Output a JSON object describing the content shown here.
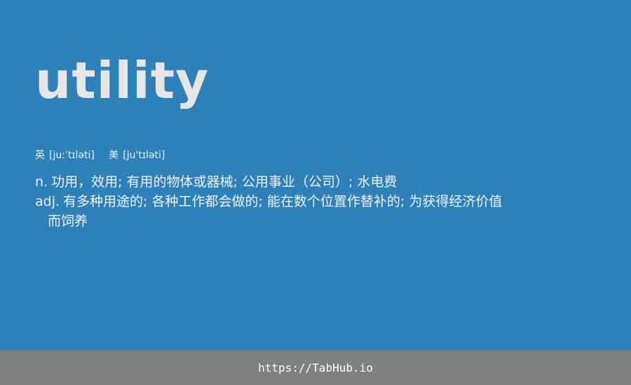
{
  "word": "utility",
  "phonetics": [
    {
      "tag": "英",
      "ipa": "[juːˈtɪləti]"
    },
    {
      "tag": "美",
      "ipa": "[ju'tɪləti]"
    }
  ],
  "definitions": [
    {
      "pos": "n.",
      "text": "功用，效用; 有用的物体或器械; 公用事业（公司）; 水电费"
    },
    {
      "pos": "adj.",
      "text": "有多种用途的; 各种工作都会做的; 能在数个位置作替补的; 为获得经济价值而饲养"
    }
  ],
  "footer": {
    "link": "https://TabHub.io"
  },
  "colors": {
    "background": "#2e80b8",
    "word": "#e6e6e6",
    "footer_bg": "#808080"
  }
}
